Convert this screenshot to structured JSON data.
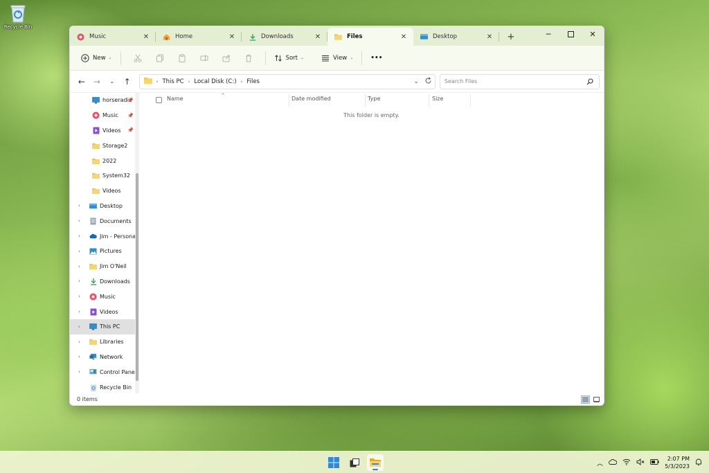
{
  "desktop": {
    "recycle_bin_label": "Recycle Bin"
  },
  "tabs": [
    {
      "label": "Music",
      "icon": "music-icon",
      "active": false
    },
    {
      "label": "Home",
      "icon": "home-icon",
      "active": false
    },
    {
      "label": "Downloads",
      "icon": "download-icon",
      "active": false
    },
    {
      "label": "Files",
      "icon": "folder-icon",
      "active": true
    },
    {
      "label": "Desktop",
      "icon": "desktop-icon",
      "active": false
    }
  ],
  "toolbar": {
    "new_label": "New",
    "sort_label": "Sort",
    "view_label": "View",
    "more_label": "•••"
  },
  "address": {
    "crumbs": [
      "This PC",
      "Local Disk (C:)",
      "Files"
    ],
    "search_placeholder": "Search Files"
  },
  "navpane": {
    "quick": [
      {
        "label": "horseradis",
        "icon": "monitor-icon",
        "pinned": true
      },
      {
        "label": "Music",
        "icon": "music-icon",
        "pinned": true
      },
      {
        "label": "Videos",
        "icon": "video-icon",
        "pinned": true
      },
      {
        "label": "Storage2",
        "icon": "folder-icon",
        "pinned": false
      },
      {
        "label": "2022",
        "icon": "folder-icon",
        "pinned": false
      },
      {
        "label": "System32",
        "icon": "folder-icon",
        "pinned": false
      },
      {
        "label": "Videos",
        "icon": "folder-icon",
        "pinned": false
      }
    ],
    "tree": [
      {
        "label": "Desktop",
        "icon": "desktop-icon",
        "selected": false,
        "expandable": true
      },
      {
        "label": "Documents",
        "icon": "documents-icon",
        "selected": false,
        "expandable": true
      },
      {
        "label": "Jim - Personal",
        "icon": "onedrive-icon",
        "selected": false,
        "expandable": true
      },
      {
        "label": "Pictures",
        "icon": "pictures-icon",
        "selected": false,
        "expandable": true
      },
      {
        "label": "Jim O'Neil",
        "icon": "folder-icon",
        "selected": false,
        "expandable": true
      },
      {
        "label": "Downloads",
        "icon": "download-icon",
        "selected": false,
        "expandable": true
      },
      {
        "label": "Music",
        "icon": "music-icon",
        "selected": false,
        "expandable": true
      },
      {
        "label": "Videos",
        "icon": "video-icon",
        "selected": false,
        "expandable": true
      },
      {
        "label": "This PC",
        "icon": "monitor-icon",
        "selected": true,
        "expandable": true
      },
      {
        "label": "Libraries",
        "icon": "folder-icon",
        "selected": false,
        "expandable": true
      },
      {
        "label": "Network",
        "icon": "network-icon",
        "selected": false,
        "expandable": true
      },
      {
        "label": "Control Panel",
        "icon": "control-panel-icon",
        "selected": false,
        "expandable": true
      },
      {
        "label": "Recycle Bin",
        "icon": "recycle-bin-icon",
        "selected": false,
        "expandable": false
      }
    ]
  },
  "filelist": {
    "columns": [
      "Name",
      "Date modified",
      "Type",
      "Size"
    ],
    "empty_message": "This folder is empty."
  },
  "status": {
    "items_text": "0 items"
  },
  "taskbar": {
    "time": "2:07 PM",
    "date": "5/3/2023"
  },
  "colors": {
    "accent": "#3a7bd5",
    "folder": "#f3c54b",
    "titlebar": "#e4eed3",
    "toolbar": "#f7fbef"
  }
}
